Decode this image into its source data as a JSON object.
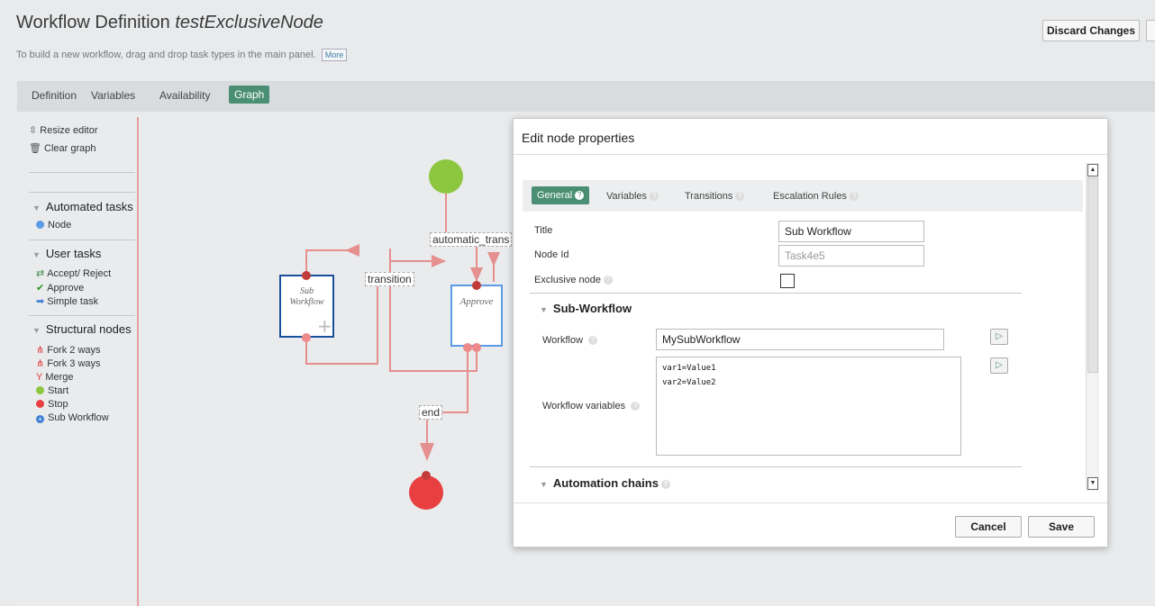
{
  "header": {
    "title_prefix": "Workflow Definition ",
    "title_name": "testExclusiveNode",
    "subtitle": "To build a new workflow, drag and drop task types in the main panel.",
    "more_label": "More",
    "discard_label": "Discard Changes"
  },
  "tabs": [
    "Definition",
    "Variables",
    "Availability",
    "Graph"
  ],
  "sidebar": {
    "resize_label": "Resize editor",
    "clear_label": "Clear graph",
    "automated_head": "Automated tasks",
    "automated_items": [
      "Node"
    ],
    "user_head": "User tasks",
    "user_items": [
      "Accept/ Reject",
      "Approve",
      "Simple task"
    ],
    "structural_head": "Structural nodes",
    "structural_items": [
      "Fork 2 ways",
      "Fork 3 ways",
      "Merge",
      "Start",
      "Stop",
      "Sub Workflow"
    ]
  },
  "graph": {
    "sub_node_line1": "Sub",
    "sub_node_line2": "Workflow",
    "approve_node": "Approve",
    "label_automatic": "automatic_trans",
    "label_transition": "transition",
    "label_end": "end"
  },
  "dialog": {
    "title": "Edit node properties",
    "tabs": [
      "General",
      "Variables",
      "Transitions",
      "Escalation Rules"
    ],
    "title_label": "Title",
    "title_value": "Sub Workflow",
    "nodeid_label": "Node Id",
    "nodeid_placeholder": "Task4e5",
    "exclusive_label": "Exclusive node",
    "subworkflow_section": "Sub-Workflow",
    "workflow_label": "Workflow",
    "workflow_value": "MySubWorkflow",
    "wfvars_label": "Workflow variables",
    "wfvars_value": "var1=Value1\nvar2=Value2",
    "automation_section": "Automation chains",
    "cancel_label": "Cancel",
    "save_label": "Save"
  },
  "colors": {
    "accent": "#4a8f74",
    "edge": "#e58f8f",
    "start_node": "#8dc63f",
    "stop_node": "#e84040",
    "sub_node_border": "#1a4fa0",
    "approve_border": "#5b9be8"
  }
}
